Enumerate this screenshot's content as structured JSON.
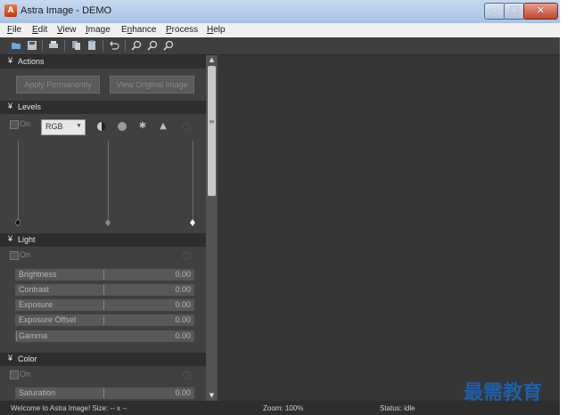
{
  "window": {
    "title": "Astra Image - DEMO"
  },
  "menu": [
    "File",
    "Edit",
    "View",
    "Image",
    "Enhance",
    "Process",
    "Help"
  ],
  "menu_underline": [
    "F",
    "E",
    "V",
    "I",
    "n",
    "P",
    "H"
  ],
  "menu_rest": [
    "ile",
    "dit",
    "iew",
    "mage",
    "hance",
    "rocess",
    "elp"
  ],
  "menu_prefix": [
    "",
    "",
    "",
    "",
    "E",
    "",
    ""
  ],
  "toolbar_icons": [
    "open-icon",
    "save-icon",
    "print-icon",
    "copy-icon",
    "paste-icon",
    "undo-icon",
    "zoom-in-icon",
    "zoom-out-icon",
    "zoom-fit-icon"
  ],
  "actions": {
    "title": "Actions",
    "apply_button": "Apply Permanently",
    "view_original_button": "View Original Image"
  },
  "levels": {
    "title": "Levels",
    "on_label": "On",
    "channel": "RGB"
  },
  "light": {
    "title": "Light",
    "on_label": "On",
    "sliders": [
      {
        "label": "Brightness",
        "value": "0.00"
      },
      {
        "label": "Contrast",
        "value": "0.00"
      },
      {
        "label": "Exposure",
        "value": "0.00"
      },
      {
        "label": "Exposure Offset",
        "value": "0.00"
      },
      {
        "label": "Gamma",
        "value": "0.00"
      }
    ]
  },
  "color": {
    "title": "Color",
    "on_label": "On",
    "sliders": [
      {
        "label": "Saturation",
        "value": "0.00"
      }
    ]
  },
  "status": {
    "message": "Welcome to Astra Image! Size: -- x --",
    "zoom": "Zoom: 100%",
    "state": "Status: idle"
  },
  "watermark": "最需教育",
  "colors": {
    "panel": "#404040",
    "canvas": "#353535",
    "titlebar": "#b7cde8"
  }
}
